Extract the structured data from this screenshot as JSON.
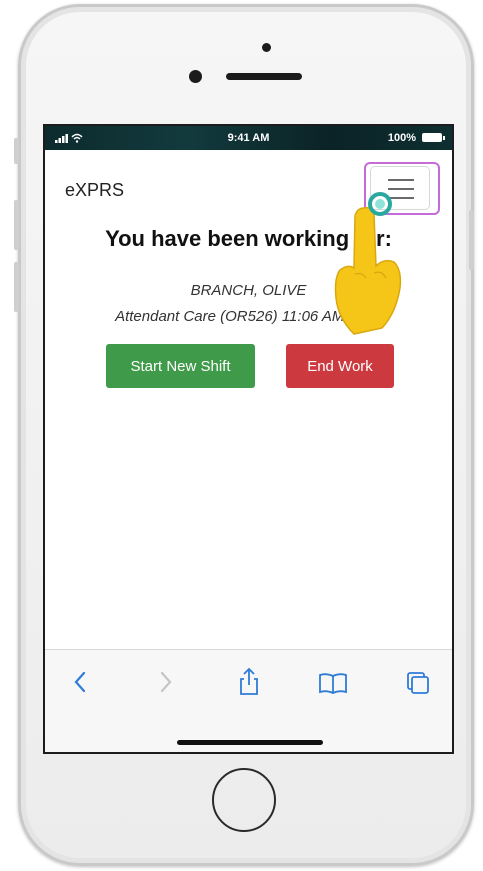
{
  "status_bar": {
    "time": "9:41 AM",
    "battery": "100%"
  },
  "navbar": {
    "brand": "eXPRS"
  },
  "main": {
    "title": "You have been working for:",
    "client_name": "BRANCH, OLIVE",
    "service_line": "Attendant Care (OR526) 11:06 AM 2020",
    "buttons": {
      "start": "Start New Shift",
      "end": "End Work"
    }
  },
  "toolbar": {
    "icons": [
      "back-icon",
      "forward-icon",
      "share-icon",
      "bookmarks-icon",
      "tabs-icon"
    ]
  },
  "colors": {
    "start_button": "#3f9a4a",
    "end_button": "#cc3a3f",
    "highlight": "#c46ad9",
    "pointer_hand": "#f5c518",
    "tap_ring": "#2aa8a0"
  }
}
